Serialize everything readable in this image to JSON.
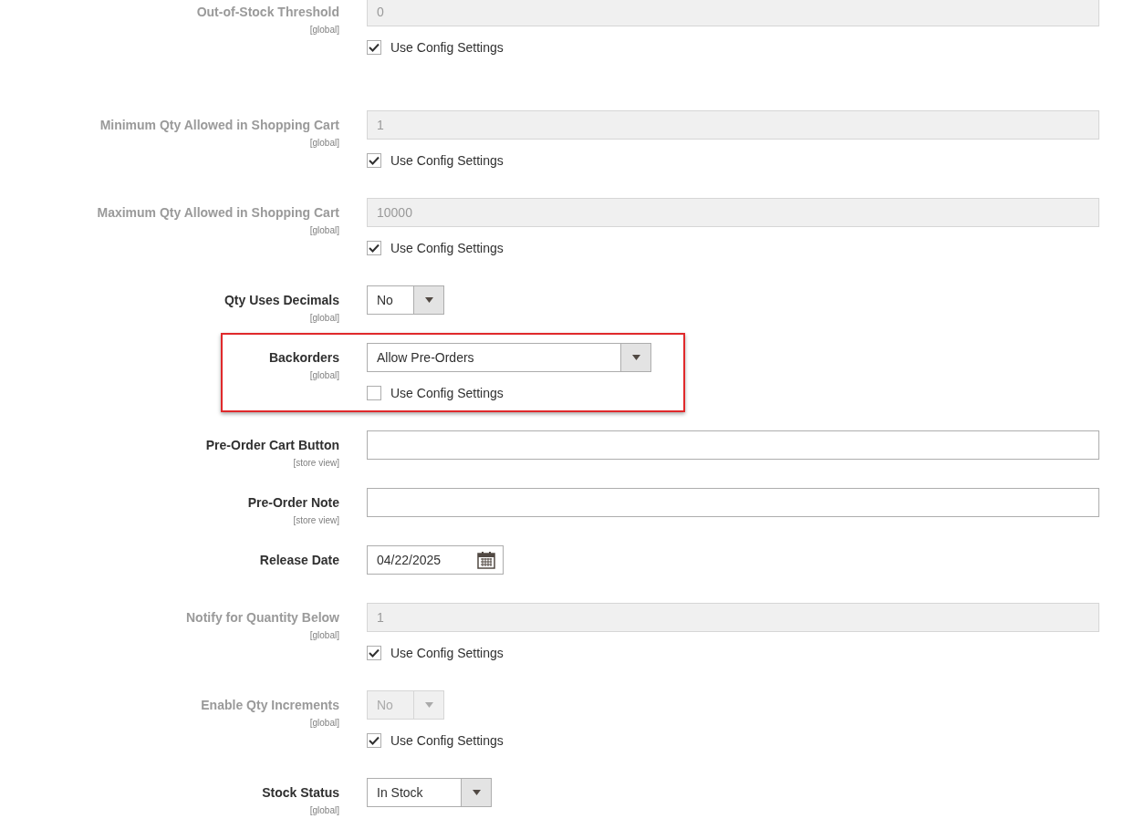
{
  "rows": [
    {
      "label": "Out-of-Stock Threshold",
      "scope": "[global]",
      "kind": "text",
      "value": "0",
      "disabled": true,
      "highlighted": false,
      "use_config": {
        "label": "Use Config Settings",
        "checked": true
      }
    },
    {
      "label": "Minimum Qty Allowed in Shopping Cart",
      "scope": "[global]",
      "kind": "text",
      "value": "1",
      "disabled": true,
      "highlighted": false,
      "use_config": {
        "label": "Use Config Settings",
        "checked": true
      }
    },
    {
      "label": "Maximum Qty Allowed in Shopping Cart",
      "scope": "[global]",
      "kind": "text",
      "value": "10000",
      "disabled": true,
      "highlighted": false,
      "use_config": {
        "label": "Use Config Settings",
        "checked": true
      }
    },
    {
      "label": "Qty Uses Decimals",
      "scope": "[global]",
      "kind": "select",
      "value": "No",
      "disabled": false,
      "highlighted": false
    },
    {
      "label": "Backorders",
      "scope": "[global]",
      "kind": "select",
      "value": "Allow Pre-Orders",
      "disabled": false,
      "highlighted": true,
      "use_config": {
        "label": "Use Config Settings",
        "checked": false
      }
    },
    {
      "label": "Pre-Order Cart Button",
      "scope": "[store view]",
      "kind": "text",
      "disabled": false,
      "highlighted": false
    },
    {
      "label": "Pre-Order Note",
      "scope": "[store view]",
      "kind": "text",
      "disabled": false,
      "highlighted": false
    },
    {
      "label": "Release Date",
      "kind": "date",
      "value": "04/22/2025",
      "disabled": false,
      "highlighted": false
    },
    {
      "label": "Notify for Quantity Below",
      "scope": "[global]",
      "kind": "text",
      "value": "1",
      "disabled": true,
      "highlighted": false,
      "use_config": {
        "label": "Use Config Settings",
        "checked": true
      }
    },
    {
      "label": "Enable Qty Increments",
      "scope": "[global]",
      "kind": "select",
      "value": "No",
      "disabled": true,
      "highlighted": false,
      "use_config": {
        "label": "Use Config Settings",
        "checked": true
      }
    },
    {
      "label": "Stock Status",
      "scope": "[global]",
      "kind": "select",
      "value": "In Stock",
      "disabled": false,
      "highlighted": false
    }
  ]
}
